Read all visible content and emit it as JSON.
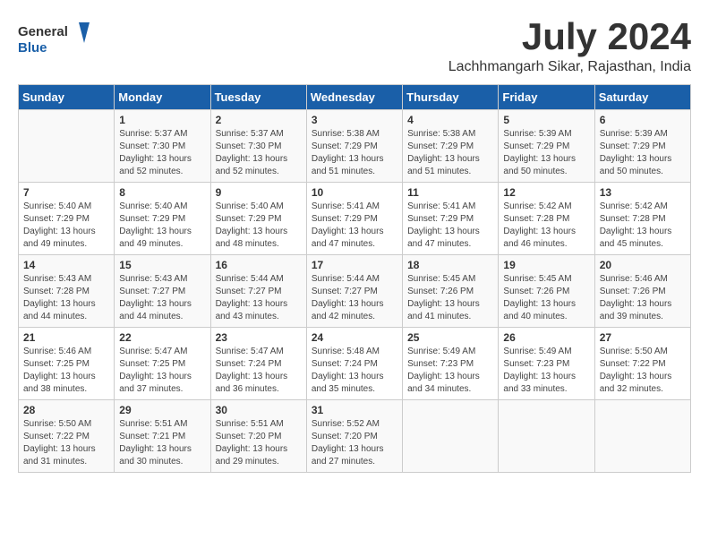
{
  "header": {
    "logo_general": "General",
    "logo_blue": "Blue",
    "month_year": "July 2024",
    "location": "Lachhmangarh Sikar, Rajasthan, India"
  },
  "days_of_week": [
    "Sunday",
    "Monday",
    "Tuesday",
    "Wednesday",
    "Thursday",
    "Friday",
    "Saturday"
  ],
  "weeks": [
    [
      {
        "day": "",
        "info": ""
      },
      {
        "day": "1",
        "info": "Sunrise: 5:37 AM\nSunset: 7:30 PM\nDaylight: 13 hours and 52 minutes."
      },
      {
        "day": "2",
        "info": "Sunrise: 5:37 AM\nSunset: 7:30 PM\nDaylight: 13 hours and 52 minutes."
      },
      {
        "day": "3",
        "info": "Sunrise: 5:38 AM\nSunset: 7:29 PM\nDaylight: 13 hours and 51 minutes."
      },
      {
        "day": "4",
        "info": "Sunrise: 5:38 AM\nSunset: 7:29 PM\nDaylight: 13 hours and 51 minutes."
      },
      {
        "day": "5",
        "info": "Sunrise: 5:39 AM\nSunset: 7:29 PM\nDaylight: 13 hours and 50 minutes."
      },
      {
        "day": "6",
        "info": "Sunrise: 5:39 AM\nSunset: 7:29 PM\nDaylight: 13 hours and 50 minutes."
      }
    ],
    [
      {
        "day": "7",
        "info": "Sunrise: 5:40 AM\nSunset: 7:29 PM\nDaylight: 13 hours and 49 minutes."
      },
      {
        "day": "8",
        "info": "Sunrise: 5:40 AM\nSunset: 7:29 PM\nDaylight: 13 hours and 49 minutes."
      },
      {
        "day": "9",
        "info": "Sunrise: 5:40 AM\nSunset: 7:29 PM\nDaylight: 13 hours and 48 minutes."
      },
      {
        "day": "10",
        "info": "Sunrise: 5:41 AM\nSunset: 7:29 PM\nDaylight: 13 hours and 47 minutes."
      },
      {
        "day": "11",
        "info": "Sunrise: 5:41 AM\nSunset: 7:29 PM\nDaylight: 13 hours and 47 minutes."
      },
      {
        "day": "12",
        "info": "Sunrise: 5:42 AM\nSunset: 7:28 PM\nDaylight: 13 hours and 46 minutes."
      },
      {
        "day": "13",
        "info": "Sunrise: 5:42 AM\nSunset: 7:28 PM\nDaylight: 13 hours and 45 minutes."
      }
    ],
    [
      {
        "day": "14",
        "info": "Sunrise: 5:43 AM\nSunset: 7:28 PM\nDaylight: 13 hours and 44 minutes."
      },
      {
        "day": "15",
        "info": "Sunrise: 5:43 AM\nSunset: 7:27 PM\nDaylight: 13 hours and 44 minutes."
      },
      {
        "day": "16",
        "info": "Sunrise: 5:44 AM\nSunset: 7:27 PM\nDaylight: 13 hours and 43 minutes."
      },
      {
        "day": "17",
        "info": "Sunrise: 5:44 AM\nSunset: 7:27 PM\nDaylight: 13 hours and 42 minutes."
      },
      {
        "day": "18",
        "info": "Sunrise: 5:45 AM\nSunset: 7:26 PM\nDaylight: 13 hours and 41 minutes."
      },
      {
        "day": "19",
        "info": "Sunrise: 5:45 AM\nSunset: 7:26 PM\nDaylight: 13 hours and 40 minutes."
      },
      {
        "day": "20",
        "info": "Sunrise: 5:46 AM\nSunset: 7:26 PM\nDaylight: 13 hours and 39 minutes."
      }
    ],
    [
      {
        "day": "21",
        "info": "Sunrise: 5:46 AM\nSunset: 7:25 PM\nDaylight: 13 hours and 38 minutes."
      },
      {
        "day": "22",
        "info": "Sunrise: 5:47 AM\nSunset: 7:25 PM\nDaylight: 13 hours and 37 minutes."
      },
      {
        "day": "23",
        "info": "Sunrise: 5:47 AM\nSunset: 7:24 PM\nDaylight: 13 hours and 36 minutes."
      },
      {
        "day": "24",
        "info": "Sunrise: 5:48 AM\nSunset: 7:24 PM\nDaylight: 13 hours and 35 minutes."
      },
      {
        "day": "25",
        "info": "Sunrise: 5:49 AM\nSunset: 7:23 PM\nDaylight: 13 hours and 34 minutes."
      },
      {
        "day": "26",
        "info": "Sunrise: 5:49 AM\nSunset: 7:23 PM\nDaylight: 13 hours and 33 minutes."
      },
      {
        "day": "27",
        "info": "Sunrise: 5:50 AM\nSunset: 7:22 PM\nDaylight: 13 hours and 32 minutes."
      }
    ],
    [
      {
        "day": "28",
        "info": "Sunrise: 5:50 AM\nSunset: 7:22 PM\nDaylight: 13 hours and 31 minutes."
      },
      {
        "day": "29",
        "info": "Sunrise: 5:51 AM\nSunset: 7:21 PM\nDaylight: 13 hours and 30 minutes."
      },
      {
        "day": "30",
        "info": "Sunrise: 5:51 AM\nSunset: 7:20 PM\nDaylight: 13 hours and 29 minutes."
      },
      {
        "day": "31",
        "info": "Sunrise: 5:52 AM\nSunset: 7:20 PM\nDaylight: 13 hours and 27 minutes."
      },
      {
        "day": "",
        "info": ""
      },
      {
        "day": "",
        "info": ""
      },
      {
        "day": "",
        "info": ""
      }
    ]
  ]
}
